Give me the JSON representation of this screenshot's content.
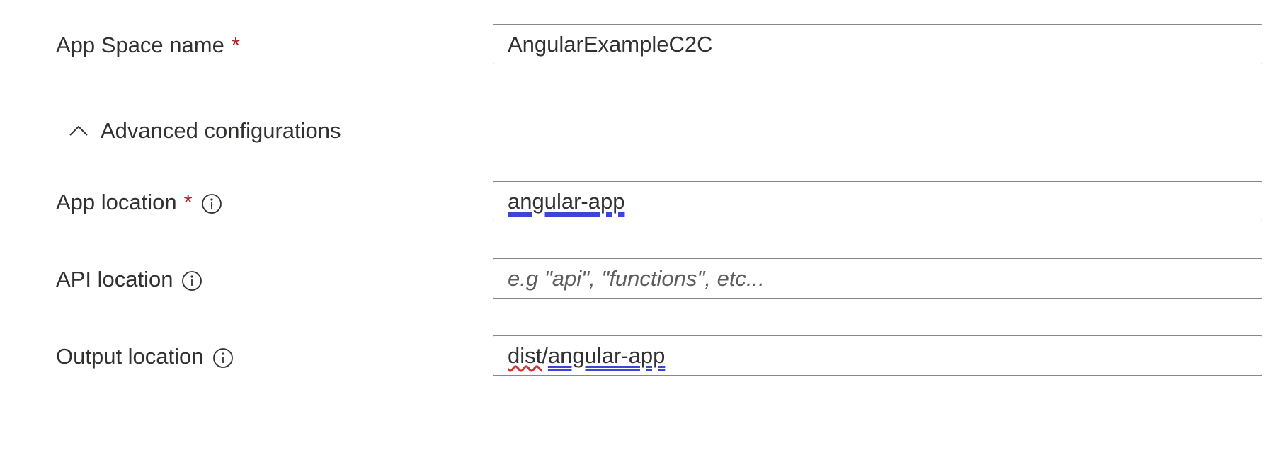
{
  "fields": {
    "app_space_name": {
      "label": "App Space name",
      "required_mark": "*",
      "value": "AngularExampleC2C"
    },
    "app_location": {
      "label": "App location",
      "required_mark": "*",
      "value": "angular-app"
    },
    "api_location": {
      "label": "API location",
      "value": "",
      "placeholder": "e.g \"api\", \"functions\", etc..."
    },
    "output_location": {
      "label": "Output location",
      "value_part1": "dist",
      "value_sep": "/",
      "value_part2": "angular-app"
    }
  },
  "advanced": {
    "label": "Advanced configurations",
    "expanded": true,
    "icon": "chevron-up-icon"
  },
  "colors": {
    "required": "#a4262c",
    "border": "#8a8886",
    "text": "#323130",
    "placeholder": "#605e5c",
    "link_underline": "#3b46d9",
    "spell_underline": "#d13438"
  }
}
